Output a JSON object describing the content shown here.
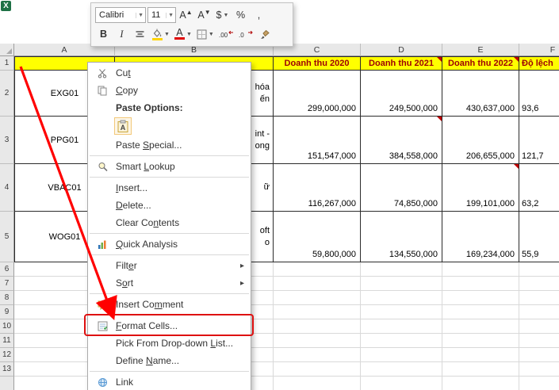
{
  "app": {
    "logo_letter": "X"
  },
  "colors": {
    "header_fill": "#FFFF00",
    "header_text_color": "#9C0006"
  },
  "annotations": {
    "arrow_color": "#FF0000",
    "highlight_box_color": "#DE1010",
    "highlighted_item": "Format Cells..."
  },
  "mini_toolbar": {
    "row1": [
      {
        "name": "font-name-select",
        "type": "combo",
        "value": "Calibri",
        "w": 64
      },
      {
        "name": "font-size-select",
        "type": "combo",
        "value": "11",
        "w": 36
      },
      {
        "name": "grow-font-button",
        "glyph": "A",
        "sup": "▲"
      },
      {
        "name": "shrink-font-button",
        "glyph": "A",
        "sup": "▼"
      },
      {
        "name": "accounting-number-format-button",
        "glyph": "$",
        "dropdown": true
      },
      {
        "name": "percent-style-button",
        "glyph": "%"
      },
      {
        "name": "comma-style-button",
        "glyph": ","
      }
    ],
    "row2": [
      {
        "name": "bold-button",
        "glyph": "B",
        "bold": true
      },
      {
        "name": "italic-button",
        "glyph": "I",
        "italic": true
      },
      {
        "name": "center-text-button",
        "icon": "align-center"
      },
      {
        "name": "fill-color-button",
        "icon": "bucket",
        "colorbar": "#FFD400",
        "dropdown": true
      },
      {
        "name": "font-color-button",
        "glyph": "A",
        "colorbar": "#E00000",
        "dropdown": true
      },
      {
        "name": "borders-button",
        "icon": "borders",
        "dropdown": true
      },
      {
        "name": "increase-decimal-button",
        "icon": "inc-decimal"
      },
      {
        "name": "decrease-decimal-button",
        "icon": "dec-decimal"
      },
      {
        "name": "format-painter-button",
        "icon": "brush"
      }
    ]
  },
  "sheet": {
    "col_labels": [
      "A",
      "B",
      "C",
      "D",
      "E",
      "F"
    ],
    "row_labels": [
      "1",
      "2",
      "3",
      "4",
      "5",
      "6",
      "7",
      "8",
      "9",
      "10",
      "11",
      "12",
      "13"
    ],
    "header_row": {
      "A": "",
      "B": "",
      "C": "Doanh thu 2020",
      "D": "Doanh thu 2021",
      "E": "Doanh thu 2022",
      "F": "Độ lệch"
    },
    "data_rows": [
      {
        "row": "2",
        "code": "EXG01",
        "name_fragments": [
          "hóa",
          "ến"
        ],
        "values": [
          "299,000,000",
          "249,500,000",
          "430,637,000"
        ],
        "deviation_fragment": "93,6"
      },
      {
        "row": "3",
        "code": "PPG01",
        "name_fragments": [
          "int -",
          "ong"
        ],
        "values": [
          "151,547,000",
          "384,558,000",
          "206,655,000"
        ],
        "deviation_fragment": "121,7"
      },
      {
        "row": "4",
        "code": "VBAC01",
        "name_fragments": [
          "ữ"
        ],
        "values": [
          "116,267,000",
          "74,850,000",
          "199,101,000"
        ],
        "deviation_fragment": "63,2"
      },
      {
        "row": "5",
        "code": "WOG01",
        "name_fragments": [
          "oft",
          "o"
        ],
        "values": [
          "59,800,000",
          "134,550,000",
          "169,234,000"
        ],
        "deviation_fragment": "55,9"
      }
    ],
    "comment_marker_cells": [
      "D1",
      "E1",
      "D3",
      "E4"
    ]
  },
  "context_menu": {
    "items": [
      {
        "name": "menu-item-cut",
        "label": "Cut",
        "icon": "scissors",
        "accel": "t"
      },
      {
        "name": "menu-item-copy",
        "label": "Copy",
        "icon": "copy",
        "accel": "C"
      },
      {
        "name": "paste-options-label",
        "label": "Paste Options:",
        "type": "heading"
      },
      {
        "name": "paste-option-paste",
        "type": "paste_icon",
        "icon": "paste-a"
      },
      {
        "name": "menu-item-paste-special",
        "label": "Paste Special...",
        "accel": "S"
      },
      {
        "type": "sep"
      },
      {
        "name": "menu-item-smart-lookup",
        "label": "Smart Lookup",
        "icon": "magnifier",
        "accel": "L"
      },
      {
        "type": "sep"
      },
      {
        "name": "menu-item-insert",
        "label": "Insert...",
        "accel": "I"
      },
      {
        "name": "menu-item-delete",
        "label": "Delete...",
        "accel": "D"
      },
      {
        "name": "menu-item-clear-contents",
        "label": "Clear Contents",
        "accel": "n"
      },
      {
        "type": "sep"
      },
      {
        "name": "menu-item-quick-analysis",
        "label": "Quick Analysis",
        "icon": "quick-analysis",
        "accel": "Q"
      },
      {
        "type": "sep"
      },
      {
        "name": "menu-item-filter",
        "label": "Filter",
        "submenu": true,
        "accel": "e"
      },
      {
        "name": "menu-item-sort",
        "label": "Sort",
        "submenu": true,
        "accel": "o"
      },
      {
        "type": "sep"
      },
      {
        "name": "menu-item-insert-comment",
        "label": "Insert Comment",
        "icon": "comment",
        "accel": "m"
      },
      {
        "type": "sep"
      },
      {
        "name": "menu-item-format-cells",
        "label": "Format Cells...",
        "icon": "format-cells",
        "accel": "F",
        "highlighted": true
      },
      {
        "name": "menu-item-pick-from-dropdown-list",
        "label": "Pick From Drop-down List...",
        "accel": "L"
      },
      {
        "name": "menu-item-define-name",
        "label": "Define Name...",
        "accel": "N"
      },
      {
        "type": "sep"
      },
      {
        "name": "menu-item-link",
        "label": "Link",
        "icon": "link"
      }
    ]
  }
}
